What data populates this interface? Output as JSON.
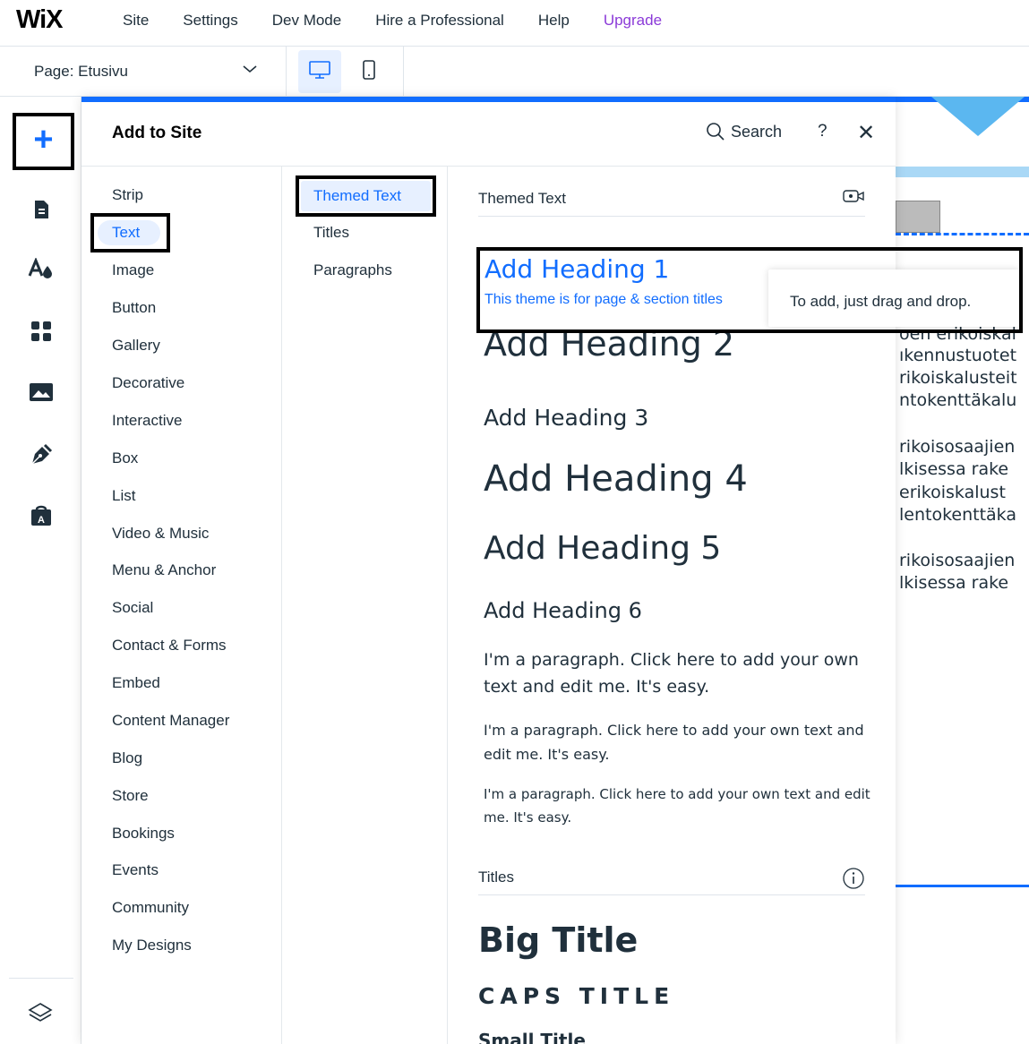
{
  "topbar": {
    "logo": "WiX",
    "menu": [
      "Site",
      "Settings",
      "Dev Mode",
      "Hire a Professional",
      "Help",
      "Upgrade"
    ]
  },
  "pagebar": {
    "page_prefix": "Page:",
    "page_name": "Etusivu"
  },
  "panel": {
    "title": "Add to Site",
    "search_label": "Search",
    "help": "?",
    "close": "✕",
    "categories": [
      "Strip",
      "Text",
      "Image",
      "Button",
      "Gallery",
      "Decorative",
      "Interactive",
      "Box",
      "List",
      "Video & Music",
      "Menu & Anchor",
      "Social",
      "Contact & Forms",
      "Embed",
      "Content Manager",
      "Blog",
      "Store",
      "Bookings",
      "Events",
      "Community",
      "My Designs"
    ],
    "selected_category": "Text",
    "subcategories": [
      "Themed Text",
      "Titles",
      "Paragraphs"
    ],
    "selected_subcategory": "Themed Text",
    "themed_section": {
      "title": "Themed Text",
      "heading1": "Add Heading 1",
      "heading1_sub": "This theme is for page & section titles",
      "tooltip": "To add, just drag and drop.",
      "heading2": "Add Heading 2",
      "heading3": "Add Heading 3",
      "heading4": "Add Heading 4",
      "heading5": "Add Heading 5",
      "heading6": "Add Heading 6",
      "para1": "I'm a paragraph. Click here to add your own text and edit me. It's easy.",
      "para2": "I'm a paragraph. Click here to add your own text and edit me. It's easy.",
      "para3": "I'm a paragraph. Click here to add your own text and edit me. It's easy."
    },
    "titles_section": {
      "title": "Titles",
      "big": "Big Title",
      "caps": "CAPS TITLE",
      "small": "Small Title"
    }
  },
  "canvas": {
    "lines": [
      "oen erikoiskal",
      "ıkennustuotet",
      "rikoiskalusteit",
      "ntokenttäkalu",
      "rikoisosaajien",
      "lkisessa rake",
      "erikoiskalust",
      "lentokenttäka",
      "rikoisosaajien",
      "lkisessa rake"
    ]
  },
  "colors": {
    "accent": "#116dff",
    "upgrade": "#8b3ad8",
    "selected_bg": "#e7f0ff"
  }
}
